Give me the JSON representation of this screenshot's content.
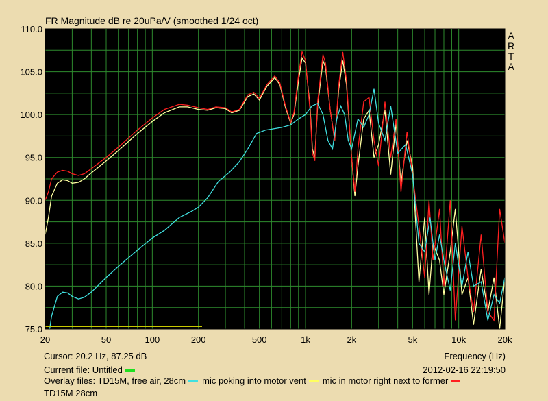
{
  "chart_data": {
    "type": "line",
    "title": "FR Magnitude dB re 20uPa/V (smoothed 1/24 oct)",
    "xlabel": "Frequency (Hz)",
    "ylabel": "",
    "xscale": "log",
    "xlim": [
      20,
      20000
    ],
    "ylim": [
      75,
      110
    ],
    "grid": true,
    "x_tick_labels": [
      {
        "value": 20,
        "label": "20"
      },
      {
        "value": 50,
        "label": "50"
      },
      {
        "value": 100,
        "label": "100"
      },
      {
        "value": 200,
        "label": "200"
      },
      {
        "value": 500,
        "label": "500"
      },
      {
        "value": 1000,
        "label": "1k"
      },
      {
        "value": 2000,
        "label": "2k"
      },
      {
        "value": 5000,
        "label": "5k"
      },
      {
        "value": 10000,
        "label": "10k"
      },
      {
        "value": 20000,
        "label": "20k"
      }
    ],
    "y_tick_labels": [
      {
        "value": 110,
        "label": "110.0"
      },
      {
        "value": 105,
        "label": "105.0"
      },
      {
        "value": 100,
        "label": "100.0"
      },
      {
        "value": 95,
        "label": "95.0"
      },
      {
        "value": 90,
        "label": "90.0"
      },
      {
        "value": 85,
        "label": "85.0"
      },
      {
        "value": 80,
        "label": "80.0"
      },
      {
        "value": 75,
        "label": "75.0"
      }
    ],
    "side_label": [
      "A",
      "R",
      "T",
      "A"
    ],
    "series": [
      {
        "color": "#ffffa0",
        "points": [
          [
            20,
            86
          ],
          [
            21,
            88
          ],
          [
            22,
            90.5
          ],
          [
            24,
            92
          ],
          [
            26,
            92.4
          ],
          [
            28,
            92.3
          ],
          [
            30,
            92
          ],
          [
            33,
            92.1
          ],
          [
            36,
            92.5
          ],
          [
            40,
            93.2
          ],
          [
            50,
            94.6
          ],
          [
            60,
            95.8
          ],
          [
            80,
            97.8
          ],
          [
            100,
            99.2
          ],
          [
            120,
            100.2
          ],
          [
            150,
            100.9
          ],
          [
            170,
            100.9
          ],
          [
            200,
            100.6
          ],
          [
            230,
            100.5
          ],
          [
            260,
            100.8
          ],
          [
            300,
            100.7
          ],
          [
            330,
            100.2
          ],
          [
            370,
            100.5
          ],
          [
            420,
            102.1
          ],
          [
            460,
            102.4
          ],
          [
            500,
            101.7
          ],
          [
            560,
            103.3
          ],
          [
            630,
            104.3
          ],
          [
            680,
            103.5
          ],
          [
            740,
            100.8
          ],
          [
            800,
            99
          ],
          [
            840,
            100
          ],
          [
            900,
            104
          ],
          [
            950,
            106.6
          ],
          [
            1000,
            106
          ],
          [
            1070,
            101
          ],
          [
            1110,
            96
          ],
          [
            1150,
            95
          ],
          [
            1200,
            101
          ],
          [
            1300,
            106.3
          ],
          [
            1350,
            105.5
          ],
          [
            1450,
            100.5
          ],
          [
            1550,
            97
          ],
          [
            1650,
            103
          ],
          [
            1750,
            106.3
          ],
          [
            1850,
            103.5
          ],
          [
            2000,
            95
          ],
          [
            2100,
            90.5
          ],
          [
            2200,
            94
          ],
          [
            2400,
            99.5
          ],
          [
            2600,
            100.5
          ],
          [
            2800,
            95
          ],
          [
            3000,
            96.5
          ],
          [
            3300,
            100.5
          ],
          [
            3600,
            93
          ],
          [
            3900,
            99
          ],
          [
            4200,
            92
          ],
          [
            4600,
            97
          ],
          [
            5000,
            94
          ],
          [
            5500,
            80.5
          ],
          [
            6000,
            88
          ],
          [
            6400,
            79
          ],
          [
            6800,
            85
          ],
          [
            7500,
            83
          ],
          [
            8000,
            79
          ],
          [
            8800,
            84
          ],
          [
            9500,
            89
          ],
          [
            10500,
            79
          ],
          [
            11500,
            81
          ],
          [
            12500,
            75.5
          ],
          [
            14000,
            82
          ],
          [
            15500,
            77
          ],
          [
            17000,
            81
          ],
          [
            18500,
            75
          ],
          [
            20000,
            81
          ]
        ]
      },
      {
        "color": "#ff2020",
        "points": [
          [
            20,
            90
          ],
          [
            21,
            91
          ],
          [
            22,
            92.5
          ],
          [
            24,
            93.3
          ],
          [
            26,
            93.5
          ],
          [
            28,
            93.4
          ],
          [
            30,
            93.1
          ],
          [
            33,
            92.9
          ],
          [
            36,
            93.1
          ],
          [
            40,
            93.7
          ],
          [
            50,
            95
          ],
          [
            60,
            96.2
          ],
          [
            80,
            98.2
          ],
          [
            100,
            99.6
          ],
          [
            120,
            100.6
          ],
          [
            150,
            101.2
          ],
          [
            170,
            101.1
          ],
          [
            200,
            100.8
          ],
          [
            230,
            100.6
          ],
          [
            260,
            100.9
          ],
          [
            300,
            100.8
          ],
          [
            330,
            100.3
          ],
          [
            370,
            100.6
          ],
          [
            420,
            102.3
          ],
          [
            460,
            102.6
          ],
          [
            500,
            101.9
          ],
          [
            560,
            103.5
          ],
          [
            630,
            104.5
          ],
          [
            680,
            103.7
          ],
          [
            740,
            101
          ],
          [
            800,
            99.1
          ],
          [
            840,
            100.2
          ],
          [
            900,
            104.6
          ],
          [
            950,
            107.3
          ],
          [
            1000,
            106.3
          ],
          [
            1070,
            100.5
          ],
          [
            1110,
            95.5
          ],
          [
            1150,
            94.6
          ],
          [
            1200,
            101.5
          ],
          [
            1300,
            107
          ],
          [
            1350,
            106
          ],
          [
            1450,
            100.5
          ],
          [
            1550,
            97
          ],
          [
            1650,
            103.5
          ],
          [
            1750,
            107.3
          ],
          [
            1850,
            104
          ],
          [
            2000,
            95
          ],
          [
            2100,
            91
          ],
          [
            2200,
            96
          ],
          [
            2400,
            101.5
          ],
          [
            2600,
            102
          ],
          [
            2800,
            97
          ],
          [
            3000,
            94
          ],
          [
            3300,
            101.5
          ],
          [
            3600,
            95
          ],
          [
            3900,
            99.5
          ],
          [
            4200,
            91
          ],
          [
            4600,
            98
          ],
          [
            5000,
            93
          ],
          [
            5500,
            87
          ],
          [
            6000,
            81
          ],
          [
            6400,
            90
          ],
          [
            6800,
            83
          ],
          [
            7500,
            89
          ],
          [
            8000,
            80
          ],
          [
            8800,
            90
          ],
          [
            9500,
            76
          ],
          [
            10500,
            87
          ],
          [
            11500,
            81
          ],
          [
            12500,
            77
          ],
          [
            14000,
            86
          ],
          [
            15500,
            77
          ],
          [
            17000,
            76
          ],
          [
            18500,
            89
          ],
          [
            20000,
            85
          ]
        ]
      },
      {
        "color": "#40e0e0",
        "points": [
          [
            20,
            72
          ],
          [
            21,
            74
          ],
          [
            22,
            76.5
          ],
          [
            24,
            78.8
          ],
          [
            26,
            79.3
          ],
          [
            28,
            79.2
          ],
          [
            30,
            78.8
          ],
          [
            33,
            78.5
          ],
          [
            36,
            78.7
          ],
          [
            40,
            79.3
          ],
          [
            50,
            81
          ],
          [
            60,
            82.3
          ],
          [
            80,
            84.2
          ],
          [
            100,
            85.6
          ],
          [
            120,
            86.5
          ],
          [
            150,
            88
          ],
          [
            180,
            88.7
          ],
          [
            200,
            89.2
          ],
          [
            230,
            90.3
          ],
          [
            270,
            92.2
          ],
          [
            320,
            93.3
          ],
          [
            370,
            94.5
          ],
          [
            420,
            96
          ],
          [
            480,
            97.8
          ],
          [
            550,
            98.2
          ],
          [
            600,
            98.3
          ],
          [
            700,
            98.5
          ],
          [
            800,
            98.8
          ],
          [
            900,
            99.5
          ],
          [
            1000,
            100
          ],
          [
            1100,
            101
          ],
          [
            1200,
            101.3
          ],
          [
            1300,
            100
          ],
          [
            1400,
            97
          ],
          [
            1500,
            96
          ],
          [
            1600,
            99.5
          ],
          [
            1700,
            101
          ],
          [
            1800,
            100
          ],
          [
            1900,
            97
          ],
          [
            2000,
            96
          ],
          [
            2200,
            99.5
          ],
          [
            2400,
            98.5
          ],
          [
            2600,
            100
          ],
          [
            2800,
            103
          ],
          [
            3000,
            99
          ],
          [
            3300,
            97
          ],
          [
            3600,
            101
          ],
          [
            4000,
            95.5
          ],
          [
            4500,
            96.5
          ],
          [
            5000,
            93
          ],
          [
            5500,
            85
          ],
          [
            6000,
            84
          ],
          [
            6500,
            88
          ],
          [
            7000,
            83
          ],
          [
            7500,
            86
          ],
          [
            8000,
            83
          ],
          [
            8800,
            79.5
          ],
          [
            9500,
            85
          ],
          [
            10500,
            80
          ],
          [
            11500,
            84
          ],
          [
            12500,
            80
          ],
          [
            14000,
            80.5
          ],
          [
            15500,
            76
          ],
          [
            17000,
            79
          ],
          [
            18500,
            78
          ],
          [
            20000,
            81
          ]
        ]
      }
    ]
  },
  "labels": {
    "cursor": "Cursor: 20.2 Hz, 87.25 dB",
    "current_file": "Current file: Untitled",
    "overlay_prefix": "Overlay files: TD15M, free air, 28cm",
    "overlay_2": "mic poking into motor vent",
    "overlay_3": "mic in motor right next to former",
    "overlay_4": "TD15M 28cm",
    "timestamp": "2012-02-16  22:19:50"
  },
  "colors": {
    "plot_bg": "#000000",
    "grid": "#2e8b2e",
    "page_bg": "#ecdcb0",
    "current_swatch": "#20e020",
    "overlay1_swatch": "#40e0e0",
    "overlay2_swatch": "#ffff60",
    "overlay3_swatch": "#ff2020",
    "baseline_line": "#c8c800"
  }
}
